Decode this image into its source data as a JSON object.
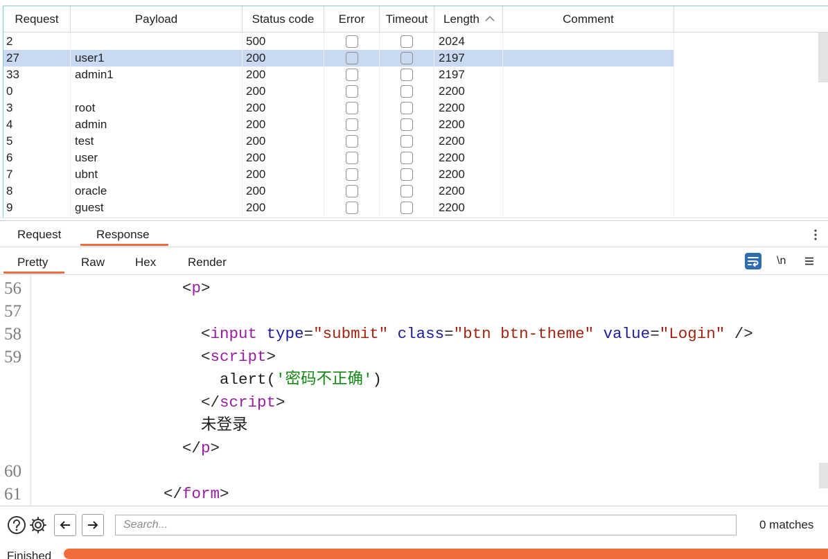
{
  "app": {
    "accent_color": "#f26b3a",
    "selected_row_color": "#c9d9f1"
  },
  "results": {
    "columns": {
      "request": "Request",
      "payload": "Payload",
      "status": "Status code",
      "error": "Error",
      "timeout": "Timeout",
      "length": "Length",
      "comment": "Comment"
    },
    "sort_icon": "chevron-up-icon",
    "rows": [
      {
        "request": "2",
        "payload": "",
        "status": "500",
        "error": false,
        "timeout": false,
        "length": "2024",
        "selected": false
      },
      {
        "request": "27",
        "payload": "user1",
        "status": "200",
        "error": false,
        "timeout": false,
        "length": "2197",
        "selected": true
      },
      {
        "request": "33",
        "payload": "admin1",
        "status": "200",
        "error": false,
        "timeout": false,
        "length": "2197",
        "selected": false
      },
      {
        "request": "0",
        "payload": "",
        "status": "200",
        "error": false,
        "timeout": false,
        "length": "2200",
        "selected": false
      },
      {
        "request": "3",
        "payload": "root",
        "status": "200",
        "error": false,
        "timeout": false,
        "length": "2200",
        "selected": false
      },
      {
        "request": "4",
        "payload": "admin",
        "status": "200",
        "error": false,
        "timeout": false,
        "length": "2200",
        "selected": false
      },
      {
        "request": "5",
        "payload": "test",
        "status": "200",
        "error": false,
        "timeout": false,
        "length": "2200",
        "selected": false
      },
      {
        "request": "6",
        "payload": "user",
        "status": "200",
        "error": false,
        "timeout": false,
        "length": "2200",
        "selected": false
      },
      {
        "request": "7",
        "payload": "ubnt",
        "status": "200",
        "error": false,
        "timeout": false,
        "length": "2200",
        "selected": false
      },
      {
        "request": "8",
        "payload": "oracle",
        "status": "200",
        "error": false,
        "timeout": false,
        "length": "2200",
        "selected": false
      },
      {
        "request": "9",
        "payload": "guest",
        "status": "200",
        "error": false,
        "timeout": false,
        "length": "2200",
        "selected": false
      }
    ]
  },
  "message_tabs": [
    {
      "label": "Request",
      "active": false
    },
    {
      "label": "Response",
      "active": true
    }
  ],
  "panel_menu_icon": "kebab-menu-icon",
  "view_tabs": [
    {
      "label": "Pretty",
      "active": true
    },
    {
      "label": "Raw",
      "active": false
    },
    {
      "label": "Hex",
      "active": false
    },
    {
      "label": "Render",
      "active": false
    }
  ],
  "editor_toolbar": {
    "wrap_icon": "word-wrap-icon",
    "newline_label": "\\n",
    "menu_icon": "hamburger-menu-icon"
  },
  "editor": {
    "lines": [
      {
        "num": "56",
        "tokens": [
          "<",
          "p",
          ">"
        ]
      },
      {
        "num": "57",
        "tokens": []
      },
      {
        "num": "58",
        "tokens": [
          "<",
          "input",
          " type",
          "=",
          "\"submit\"",
          " class",
          "=",
          "\"btn btn-theme\"",
          " value",
          "=",
          "\"Login\"",
          " />"
        ]
      },
      {
        "num": "59",
        "tokens": [
          "<",
          "script",
          ">"
        ]
      },
      {
        "num": "",
        "tokens": [
          "alert(",
          "'密码不正确'",
          ")"
        ]
      },
      {
        "num": "",
        "tokens": [
          "</",
          "script",
          ">"
        ]
      },
      {
        "num": "",
        "tokens": [
          "未登录"
        ]
      },
      {
        "num": "",
        "tokens": [
          "</",
          "p",
          ">"
        ]
      },
      {
        "num": "60",
        "tokens": []
      },
      {
        "num": "61",
        "tokens": [
          "</",
          "form",
          ">"
        ]
      }
    ]
  },
  "footer": {
    "help_icon": "help-icon",
    "settings_icon": "gear-icon",
    "back_icon": "arrow-left-icon",
    "forward_icon": "arrow-right-icon",
    "search_placeholder": "Search...",
    "matches": "0 matches"
  },
  "status": {
    "label": "Finished",
    "progress": 1
  }
}
